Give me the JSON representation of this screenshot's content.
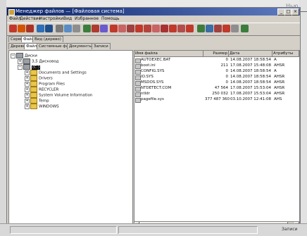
{
  "window": {
    "title": "Менеджер файлов — [Файловая система]",
    "corner_label": "Нью"
  },
  "menu": [
    "Файл",
    "Действие",
    "Настройки",
    "Вид",
    "Избранное",
    "Помощь"
  ],
  "tabs_top": [
    "Сервис",
    "Файлы",
    "Вид (дерево)"
  ],
  "tabs_bottom": [
    "Дерево",
    "Файлы",
    "Системные файлы",
    "Документы",
    "Записи"
  ],
  "tree": [
    {
      "label": "Диски",
      "level": 0,
      "kind": "drive"
    },
    {
      "label": "3,5 Дисковод",
      "level": 1,
      "kind": "drive"
    },
    {
      "label": "(C:)",
      "level": 1,
      "kind": "drive",
      "selected": true
    },
    {
      "label": "Documents and Settings",
      "level": 2,
      "kind": "folder"
    },
    {
      "label": "Drivers",
      "level": 2,
      "kind": "folder"
    },
    {
      "label": "Program Files",
      "level": 2,
      "kind": "folder"
    },
    {
      "label": "RECYCLER",
      "level": 2,
      "kind": "folder"
    },
    {
      "label": "System Volume Information",
      "level": 2,
      "kind": "folder"
    },
    {
      "label": "Temp",
      "level": 2,
      "kind": "folder"
    },
    {
      "label": "WINDOWS",
      "level": 2,
      "kind": "folder"
    }
  ],
  "columns": [
    "Имя файла",
    "Размер",
    "Дата",
    "Атрибуты"
  ],
  "files": [
    {
      "name": "AUTOEXEC.BAT",
      "size": "0",
      "date": "14.08.2007 18:58:54",
      "attr": "A"
    },
    {
      "name": "boot.ini",
      "size": "211",
      "date": "17.08.2007 15:48:08",
      "attr": "AHSR"
    },
    {
      "name": "CONFIG.SYS",
      "size": "0",
      "date": "14.08.2007 18:58:54",
      "attr": "A"
    },
    {
      "name": "IO.SYS",
      "size": "0",
      "date": "14.08.2007 18:58:54",
      "attr": "AHSR"
    },
    {
      "name": "MSDOS.SYS",
      "size": "0",
      "date": "14.08.2007 18:58:54",
      "attr": "AHSR"
    },
    {
      "name": "NTDETECT.COM",
      "size": "47 564",
      "date": "17.08.2007 15:53:04",
      "attr": "AHSR"
    },
    {
      "name": "ntldr",
      "size": "250 032",
      "date": "17.08.2007 15:53:04",
      "attr": "AHSR"
    },
    {
      "name": "pagefile.sys",
      "size": "377 487 360",
      "date": "03.10.2007 12:41:08",
      "attr": "AHS"
    }
  ],
  "status": {
    "left": "",
    "right": "Записи"
  }
}
